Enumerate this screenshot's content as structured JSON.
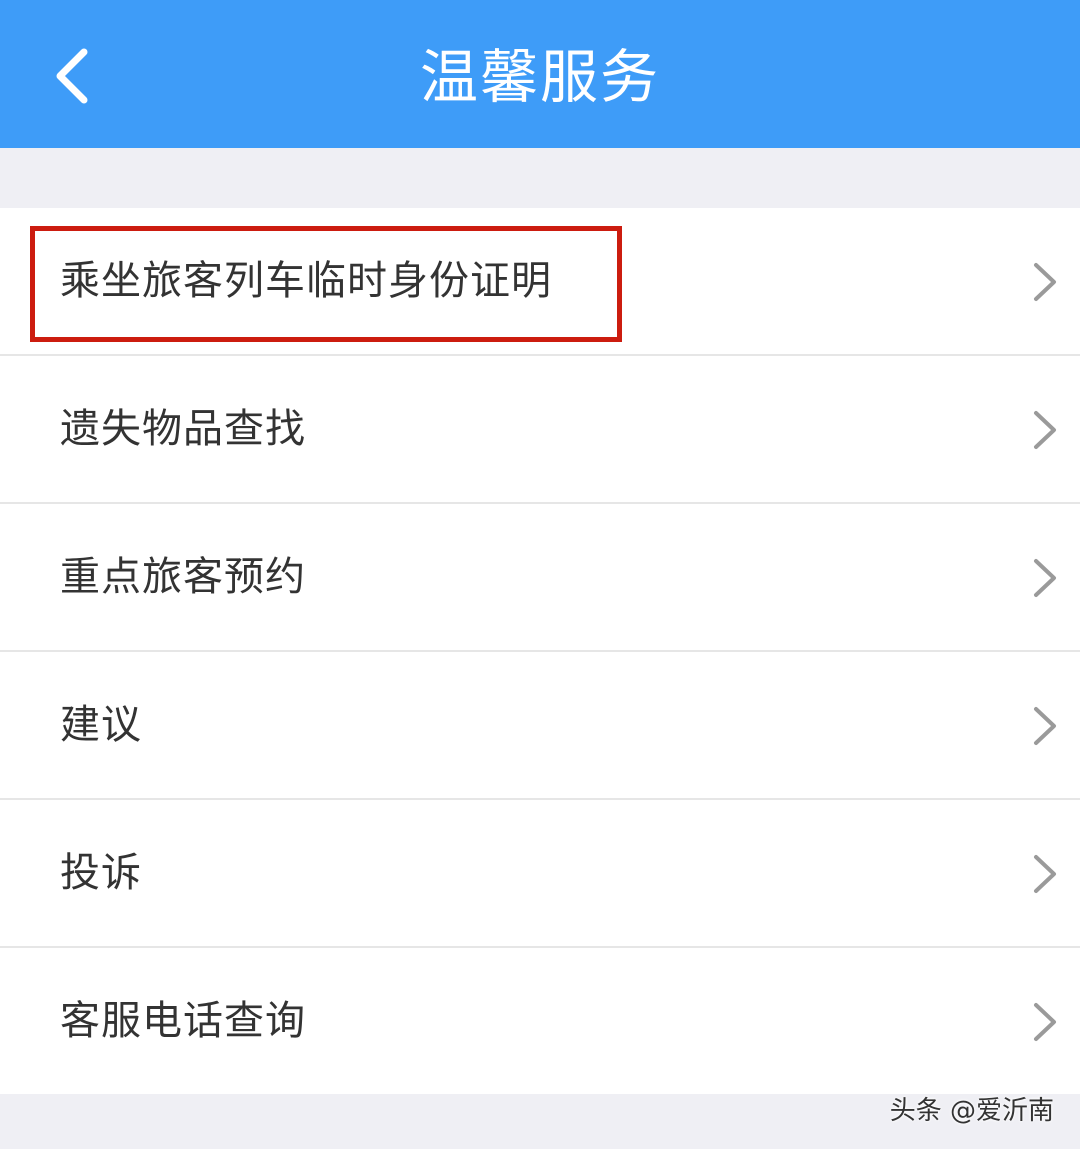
{
  "header": {
    "title": "温馨服务",
    "back_icon": "chevron-left-icon",
    "background_color": "#3e9cf8"
  },
  "menu": {
    "items": [
      {
        "label": "乘坐旅客列车临时身份证明",
        "icon": "chevron-right-icon",
        "highlighted": true
      },
      {
        "label": "遗失物品查找",
        "icon": "chevron-right-icon"
      },
      {
        "label": "重点旅客预约",
        "icon": "chevron-right-icon"
      },
      {
        "label": "建议",
        "icon": "chevron-right-icon"
      },
      {
        "label": "投诉",
        "icon": "chevron-right-icon"
      },
      {
        "label": "客服电话查询",
        "icon": "chevron-right-icon"
      }
    ]
  },
  "annotation": {
    "highlight_color": "#cc1c0f"
  },
  "watermark": {
    "text": "头条 @爱沂南"
  }
}
